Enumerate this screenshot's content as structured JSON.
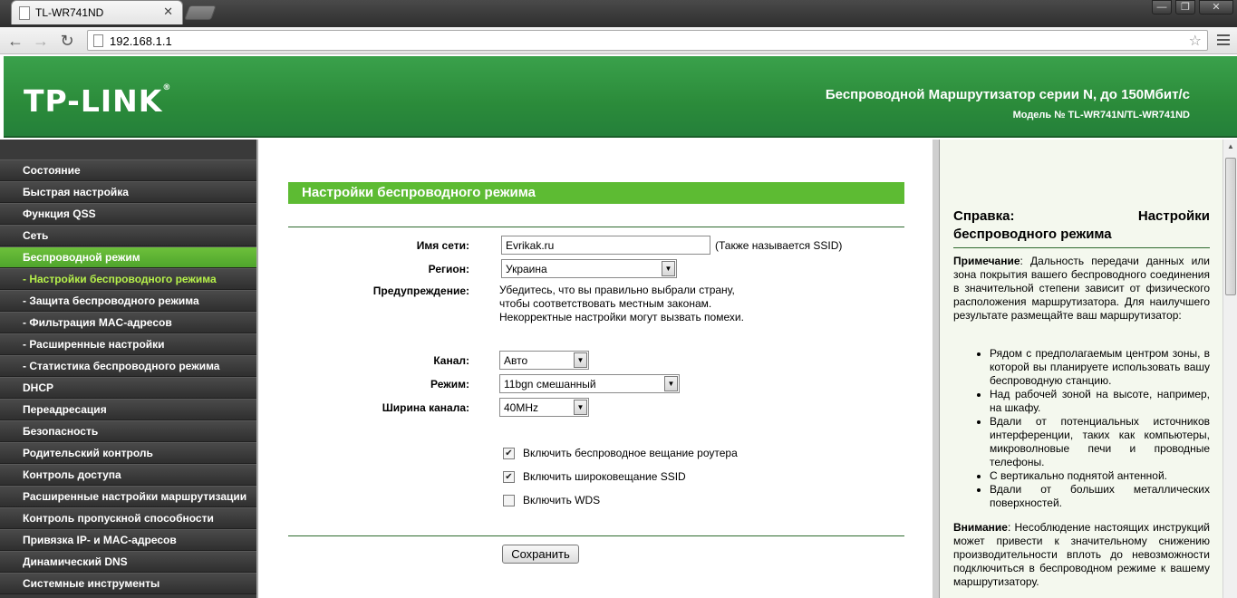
{
  "browser": {
    "tab_title": "TL-WR741ND",
    "tab_close": "✕",
    "url": "192.168.1.1",
    "window_buttons": [
      "—",
      "❐",
      "✕"
    ]
  },
  "header": {
    "logo": "TP-LINK",
    "logo_mark": "®",
    "title": "Беспроводной Маршрутизатор серии N, до 150Мбит/с",
    "model": "Модель № TL-WR741N/TL-WR741ND"
  },
  "menu": {
    "items": [
      {
        "label": "Состояние"
      },
      {
        "label": "Быстрая настройка"
      },
      {
        "label": "Функция QSS"
      },
      {
        "label": "Сеть"
      },
      {
        "label": "Беспроводной режим"
      },
      {
        "label": "- Настройки беспроводного режима"
      },
      {
        "label": "- Защита беспроводного режима"
      },
      {
        "label": "- Фильтрация MAC-адресов"
      },
      {
        "label": "- Расширенные настройки"
      },
      {
        "label": "- Статистика беспроводного режима"
      },
      {
        "label": "DHCP"
      },
      {
        "label": "Переадресация"
      },
      {
        "label": "Безопасность"
      },
      {
        "label": "Родительский контроль"
      },
      {
        "label": "Контроль доступа"
      },
      {
        "label": "Расширенные настройки маршрутизации"
      },
      {
        "label": "Контроль пропускной способности"
      },
      {
        "label": "Привязка IP- и MAC-адресов"
      },
      {
        "label": "Динамический DNS"
      },
      {
        "label": "Системные инструменты"
      }
    ]
  },
  "main": {
    "section_title": "Настройки беспроводного режима",
    "ssid_label": "Имя сети:",
    "ssid_value": "Evrikak.ru",
    "ssid_hint": "(Также называется SSID)",
    "region_label": "Регион:",
    "region_value": "Украина",
    "warning_label": "Предупреждение:",
    "warning_lines": [
      "Убедитесь, что вы правильно выбрали страну,",
      "чтобы соответствовать местным законам.",
      "Некорректные настройки могут вызвать помехи."
    ],
    "channel_label": "Канал:",
    "channel_value": "Авто",
    "mode_label": "Режим:",
    "mode_value": "11bgn смешанный",
    "width_label": "Ширина канала:",
    "width_value": "40MHz",
    "checkboxes": [
      {
        "label": "Включить беспроводное вещание роутера",
        "checked": true,
        "mark": "✔"
      },
      {
        "label": "Включить широковещание SSID",
        "checked": true,
        "mark": "✔"
      },
      {
        "label": "Включить WDS",
        "checked": false,
        "mark": ""
      }
    ],
    "save_label": "Сохранить"
  },
  "help": {
    "title_left": "Справка:",
    "title_right": "Настройки",
    "title_line2": "беспроводного режима",
    "note_label": "Примечание",
    "note_text": ": Дальность передачи данных или зона покрытия вашего беспроводного соединения в значительной степени зависит от физического расположения маршрутизатора. Для наилучшего результате размещайте ваш маршрутизатор:",
    "bullets": [
      "Рядом с предполагаемым центром зоны, в которой вы планируете использовать вашу беспроводную станцию.",
      "Над рабочей зоной на высоте, например, на шкафу.",
      "Вдали от потенциальных источников интерференции, таких как компьютеры, микроволновые печи и проводные телефоны.",
      "С вертикально поднятой антенной.",
      "Вдали от больших металлических поверхностей."
    ],
    "warn_label": "Внимание",
    "warn_text": ": Несоблюдение настоящих инструкций может привести к значительному снижению производительности вплоть до невозможности подключиться в беспроводном режиме к вашему маршрутизатору."
  }
}
